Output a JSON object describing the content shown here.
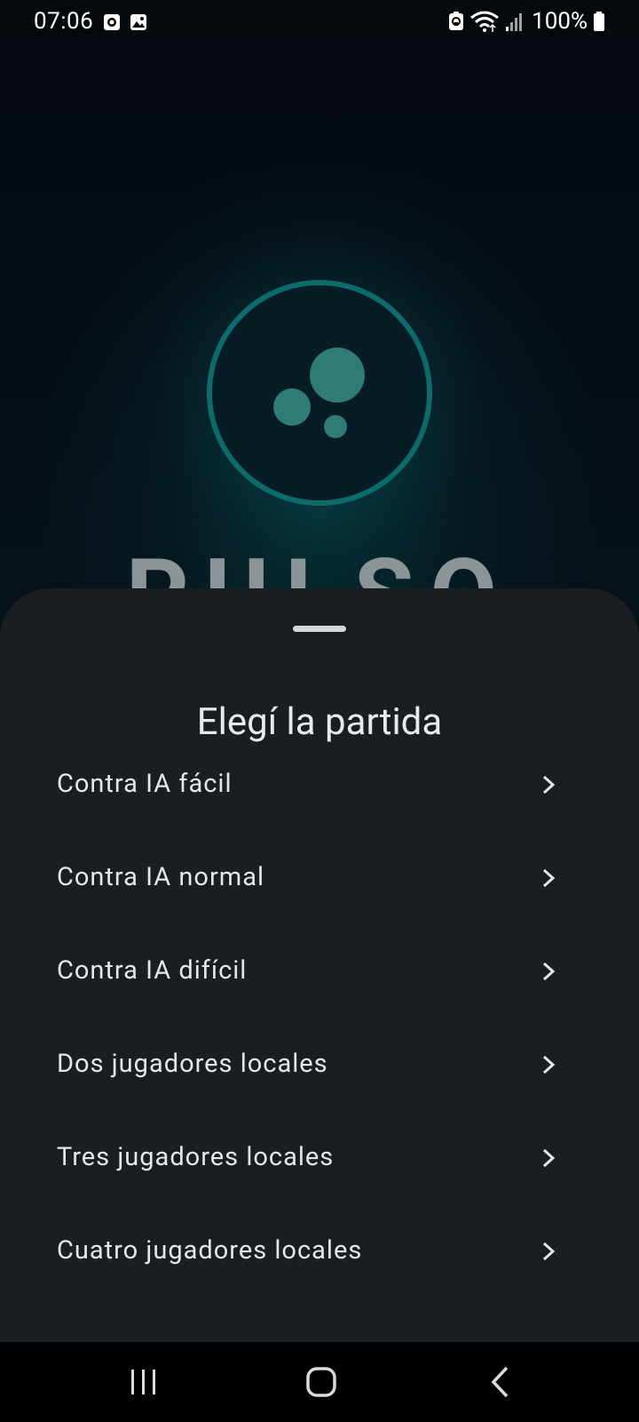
{
  "status_bar": {
    "time": "07:06",
    "battery": "100%",
    "left_icons": [
      "screen-record-icon",
      "gallery-icon"
    ],
    "right_icons": [
      "sync-lock-icon",
      "wifi-icon",
      "signal-icon",
      "battery-icon"
    ]
  },
  "splash": {
    "title": "PULSO",
    "logo_icon": "bubbles-logo-icon",
    "accent_color": "#0e6b6b",
    "dot_color": "#2f7c74"
  },
  "sheet": {
    "title": "Elegí la partida",
    "options": [
      {
        "label": "Contra IA fácil",
        "icon": "chevron-right-icon"
      },
      {
        "label": "Contra IA normal",
        "icon": "chevron-right-icon"
      },
      {
        "label": "Contra IA difícil",
        "icon": "chevron-right-icon"
      },
      {
        "label": "Dos jugadores locales",
        "icon": "chevron-right-icon"
      },
      {
        "label": "Tres jugadores locales",
        "icon": "chevron-right-icon"
      },
      {
        "label": "Cuatro jugadores locales",
        "icon": "chevron-right-icon"
      }
    ],
    "background_color": "#1a1e22"
  },
  "nav_bar": {
    "buttons": [
      "recents-icon",
      "home-icon",
      "back-icon"
    ]
  }
}
